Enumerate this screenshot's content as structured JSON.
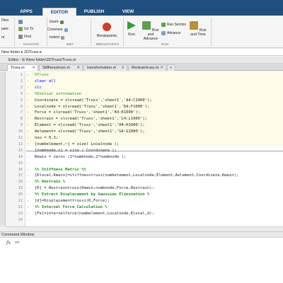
{
  "ribbon_tabs": [
    "APPS",
    "EDITOR",
    "PUBLISH",
    "VIEW"
  ],
  "ribbon": {
    "file_items": [
      "Files",
      "pare",
      "nt"
    ],
    "navigate": {
      "find_files": "Find Files",
      "go_to": "Go To",
      "find": "Find",
      "label": "NAVIGATE"
    },
    "edit": {
      "insert": "Insert",
      "comment": "Comment",
      "indent": "Indent",
      "label": "EDIT"
    },
    "breakpoints": {
      "button": "Breakpoints",
      "label": "BREAKPOINTS"
    },
    "run": {
      "run": "Run",
      "run_and_advance": "Run and Advance",
      "run_section": "Run Section",
      "advance": "Advance",
      "run_and_time": "Run and Time",
      "label": "RUN"
    }
  },
  "address_bar": "New folder  ▸  2DTruss  ▸",
  "editor_title": "Editor - E:\\New folder\\2DTruss\\Truss.m",
  "file_tabs": [
    "Truss.m",
    "Stiffnesstruss.m",
    "transformation.m",
    "Restraintruss.m"
  ],
  "code_lines": [
    {
      "n": "1",
      "text": "%Truss"
    },
    {
      "n": "2",
      "text": "clear all"
    },
    {
      "n": "3",
      "text": "clc"
    },
    {
      "n": "4",
      "text": "%Initial information"
    },
    {
      "n": "5",
      "text": "Coordinate = xlsread('Truss','sheet1','A4:C1000');"
    },
    {
      "n": "6",
      "text": "Localnode = xlsread('Truss','sheet1','D4:F1000');"
    },
    {
      "n": "7",
      "text": "Force = xlsread('Truss','sheet1','K4:K1000');"
    },
    {
      "n": "8",
      "text": "Restrain = xlsread('Truss','sheet1','L4:L1000');"
    },
    {
      "n": "9",
      "text": "Element = xlsread('Truss','sheet1','H4:H1000');"
    },
    {
      "n": "10",
      "text": "Aelement= xlsread('Truss','sheet1','G4:G1000');"
    },
    {
      "n": "11",
      "text": "nuu = 0.3;"
    },
    {
      "n": "12",
      "text": "[numbelement,~] = size( Localnode );"
    },
    {
      "n": "13",
      "text": "[numbnode,n] = size ( Coordinate );"
    },
    {
      "n": "14",
      "text": "Kmain = zeros (2*numbnode,2*numbnode );"
    },
    {
      "n": "15",
      "text": ""
    },
    {
      "n": "16",
      "text": "%% Stiffness Matrix %%"
    },
    {
      "n": "17",
      "text": "[Klocal,Kmain]=stiffnesstruss(numbelement,Localnode,Element,Aelement,Coordinate,Kmain);"
    },
    {
      "n": "18",
      "text": "%% Restrain %"
    },
    {
      "n": "19",
      "text": "[K] = Restraintruss(Kmain,numbnode,Force,Restrain);"
    },
    {
      "n": "20",
      "text": "%% Extract Displacement by Gaussian Elimination %"
    },
    {
      "n": "21",
      "text": "[d]=Displacementtrussi(K,Force);"
    },
    {
      "n": "22",
      "text": "%% Internal Force Calculation %"
    },
    {
      "n": "23",
      "text": "[Fe]=internalforce(numbelement,Localnode,Klocal,d);"
    },
    {
      "n": "24",
      "text": ""
    }
  ],
  "command_window": {
    "title": "Command Window",
    "fx": "fx",
    "prompt": ">>"
  }
}
